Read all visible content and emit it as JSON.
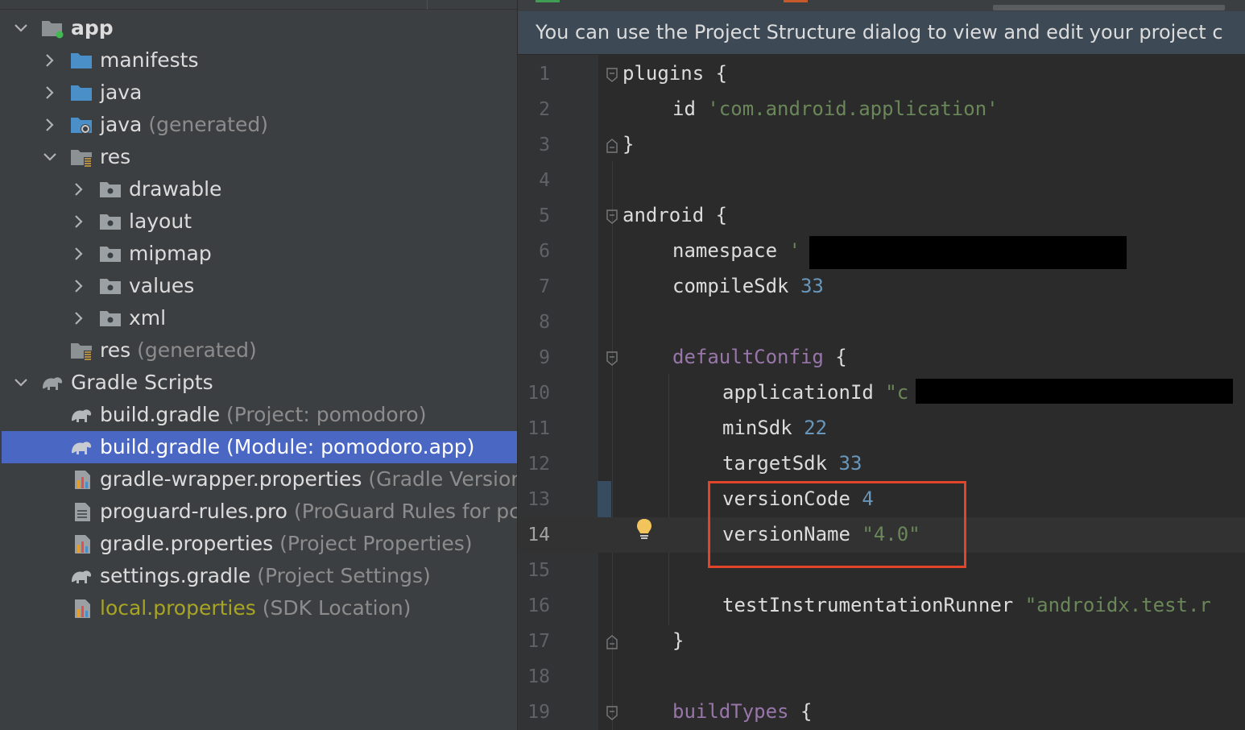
{
  "tree": {
    "rows": [
      {
        "label": "app",
        "hint": ""
      },
      {
        "label": "manifests",
        "hint": ""
      },
      {
        "label": "java",
        "hint": ""
      },
      {
        "label": "java",
        "hint": "(generated)"
      },
      {
        "label": "res",
        "hint": ""
      },
      {
        "label": "drawable",
        "hint": ""
      },
      {
        "label": "layout",
        "hint": ""
      },
      {
        "label": "mipmap",
        "hint": ""
      },
      {
        "label": "values",
        "hint": ""
      },
      {
        "label": "xml",
        "hint": ""
      },
      {
        "label": "res",
        "hint": "(generated)"
      },
      {
        "label": "Gradle Scripts",
        "hint": ""
      },
      {
        "label": "build.gradle",
        "hint": "(Project: pomodoro)"
      },
      {
        "label": "build.gradle",
        "hint": "(Module: pomodoro.app)"
      },
      {
        "label": "gradle-wrapper.properties",
        "hint": "(Gradle Versior"
      },
      {
        "label": "proguard-rules.pro",
        "hint": "(ProGuard Rules for pc"
      },
      {
        "label": "gradle.properties",
        "hint": "(Project Properties)"
      },
      {
        "label": "settings.gradle",
        "hint": "(Project Settings)"
      },
      {
        "label": "local.properties",
        "hint": "(SDK Location)"
      }
    ]
  },
  "editor": {
    "banner": "You can use the Project Structure dialog to view and edit your project c",
    "current_line": 14,
    "lines": [
      {
        "n": "1",
        "t": [
          {
            "c": "plain",
            "s": "plugins {"
          }
        ]
      },
      {
        "n": "2",
        "t": [
          {
            "c": "plain",
            "s": "id "
          },
          {
            "c": "str",
            "s": "'com.android.application'"
          }
        ]
      },
      {
        "n": "3",
        "t": [
          {
            "c": "plain",
            "s": "}"
          }
        ]
      },
      {
        "n": "4",
        "t": []
      },
      {
        "n": "5",
        "t": [
          {
            "c": "plain",
            "s": "android {"
          }
        ]
      },
      {
        "n": "6",
        "t": [
          {
            "c": "plain",
            "s": "namespace "
          },
          {
            "c": "str",
            "s": "'"
          }
        ]
      },
      {
        "n": "7",
        "t": [
          {
            "c": "plain",
            "s": "compileSdk "
          },
          {
            "c": "num",
            "s": "33"
          }
        ]
      },
      {
        "n": "8",
        "t": []
      },
      {
        "n": "9",
        "t": [
          {
            "c": "prop",
            "s": "defaultConfig"
          },
          {
            "c": "plain",
            "s": " {"
          }
        ]
      },
      {
        "n": "10",
        "t": [
          {
            "c": "plain",
            "s": "applicationId "
          },
          {
            "c": "str",
            "s": "\"c"
          }
        ]
      },
      {
        "n": "11",
        "t": [
          {
            "c": "plain",
            "s": "minSdk "
          },
          {
            "c": "num",
            "s": "22"
          }
        ]
      },
      {
        "n": "12",
        "t": [
          {
            "c": "plain",
            "s": "targetSdk "
          },
          {
            "c": "num",
            "s": "33"
          }
        ]
      },
      {
        "n": "13",
        "t": [
          {
            "c": "plain",
            "s": "versionCode "
          },
          {
            "c": "num",
            "s": "4"
          }
        ]
      },
      {
        "n": "14",
        "t": [
          {
            "c": "plain",
            "s": "versionName "
          },
          {
            "c": "str",
            "s": "\"4.0\""
          }
        ]
      },
      {
        "n": "15",
        "t": []
      },
      {
        "n": "16",
        "t": [
          {
            "c": "plain",
            "s": "testInstrumentationRunner "
          },
          {
            "c": "str",
            "s": "\"androidx.test.r"
          }
        ]
      },
      {
        "n": "17",
        "t": [
          {
            "c": "plain",
            "s": "}"
          }
        ]
      },
      {
        "n": "18",
        "t": []
      },
      {
        "n": "19",
        "t": [
          {
            "c": "prop",
            "s": "buildTypes"
          },
          {
            "c": "plain",
            "s": " {"
          }
        ]
      }
    ]
  },
  "colors": {
    "selection": "#4a67c4",
    "highlight_box": "#e0442b",
    "string": "#6a8759",
    "number": "#6897bb",
    "property": "#9876aa"
  }
}
